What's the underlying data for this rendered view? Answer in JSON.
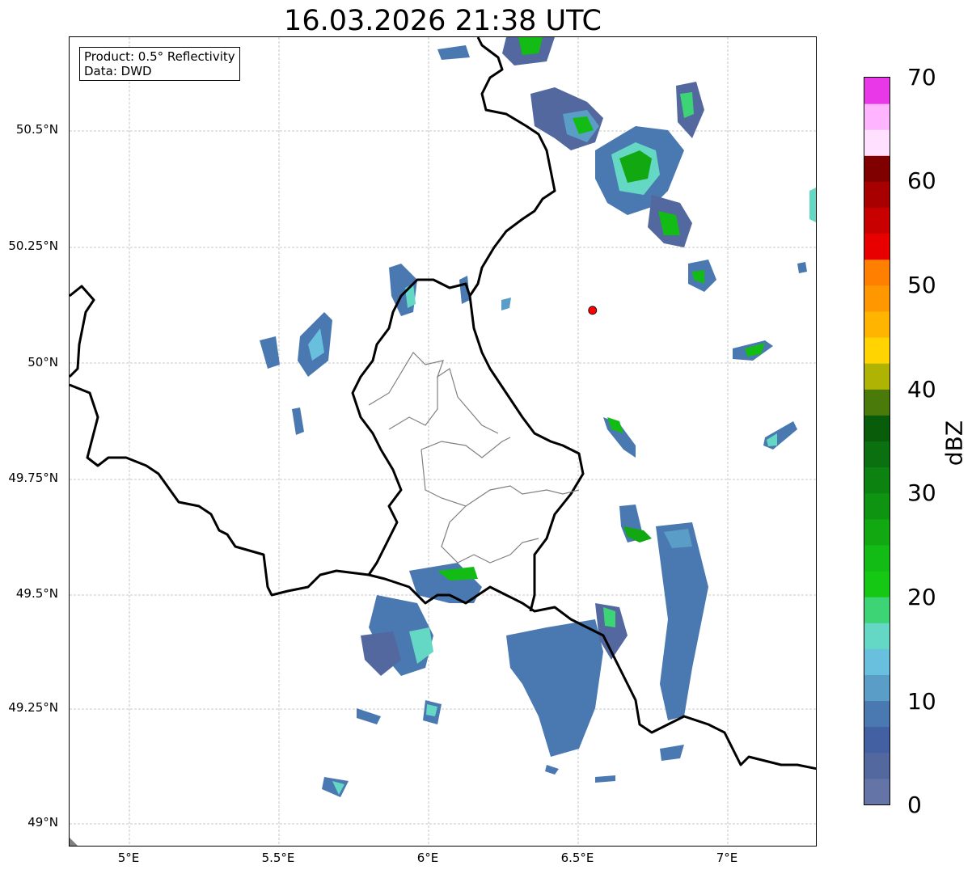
{
  "title": "16.03.2026 21:38 UTC",
  "info": {
    "product": "Product: 0.5° Reflectivity",
    "data": "Data: DWD"
  },
  "latitude_labels": [
    "50.5°N",
    "50.25°N",
    "50°N",
    "49.75°N",
    "49.5°N",
    "49.25°N",
    "49°N"
  ],
  "longitude_labels": [
    "5°E",
    "5.5°E",
    "6°E",
    "6.5°E",
    "7°E"
  ],
  "colorbar": {
    "unit": "dBZ",
    "tick_labels": [
      "0",
      "10",
      "20",
      "30",
      "40",
      "50",
      "60",
      "70"
    ],
    "min": 0,
    "max": 70,
    "step": 2.5,
    "colors": [
      "#6474a6",
      "#52689e",
      "#4260a2",
      "#4a78b0",
      "#5a9ec8",
      "#68c0de",
      "#64d8c4",
      "#3cd474",
      "#14c814",
      "#12bc14",
      "#12a812",
      "#0e9410",
      "#0c8210",
      "#0a7010",
      "#085c0a",
      "#4a7a0a",
      "#afb404",
      "#ffd400",
      "#ffb400",
      "#ff9800",
      "#ff8000",
      "#e80000",
      "#c80000",
      "#a80000",
      "#800000",
      "#ffe0ff",
      "#ffb4ff",
      "#ff70ff",
      "#e838e8"
    ]
  },
  "map": {
    "extent": {
      "lon_min": 4.8,
      "lon_max": 7.3,
      "lat_min": 48.95,
      "lat_max": 50.7
    },
    "radar_site_marker": {
      "lon": 6.548,
      "lat": 50.11,
      "color": "#ff0000"
    },
    "gridlines": true
  }
}
